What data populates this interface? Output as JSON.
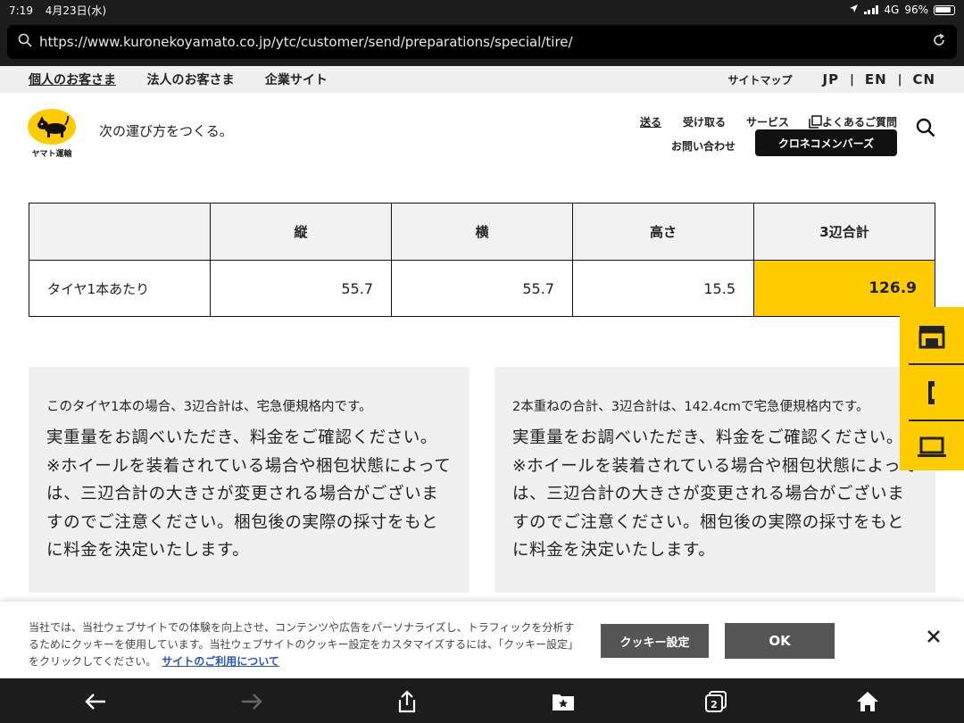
{
  "status_bar": {
    "time": "7:19",
    "date": "4月23日(水)",
    "network": "4G",
    "battery": "96%"
  },
  "browser": {
    "url": "https://www.kuronekoyamato.co.jp/ytc/customer/send/preparations/special/tire/"
  },
  "top_nav": {
    "links": [
      "個人のお客さま",
      "法人のお客さま",
      "企業サイト"
    ],
    "sitemap": "サイトマップ",
    "languages": [
      "JP",
      "EN",
      "CN"
    ],
    "separator": "|"
  },
  "header": {
    "logo_caption": "ヤマト運輸",
    "tagline": "次の運び方をつくる。",
    "nav": {
      "send": "送る",
      "receive": "受け取る",
      "service": "サービス",
      "faq": "よくあるご質問",
      "contact": "お問い合わせ",
      "members": "クロネコメンバーズ"
    }
  },
  "table": {
    "headers": [
      "",
      "縦",
      "横",
      "高さ",
      "3辺合計"
    ],
    "row": {
      "label": "タイヤ1本あたり",
      "length": "55.7",
      "width": "55.7",
      "height": "15.5",
      "total": "126.9"
    }
  },
  "info_boxes": [
    {
      "lead": "このタイヤ1本の場合、3辺合計は、宅急便規格内です。",
      "body": "実重量をお調べいただき、料金をご確認ください。※ホイールを装着されている場合や梱包状態によっては、三辺合計の大きさが変更される場合がございますのでご注意ください。梱包後の実際の採寸をもとに料金を決定いたします。"
    },
    {
      "lead": "2本重ねの合計、3辺合計は、142.4cmで宅急便規格内です。",
      "body": "実重量をお調べいただき、料金をご確認ください。※ホイールを装着されている場合や梱包状態によっては、三辺合計の大きさが変更される場合がございますのでご注意ください。梱包後の実際の採寸をもとに料金を決定いたします。"
    }
  ],
  "cookie_banner": {
    "text": "当社では、当社ウェブサイトでの体験を向上させ、コンテンツや広告をパーソナライズし、トラフィックを分析するためにクッキーを使用しています。当社ウェブサイトのクッキー設定をカスタマイズするには、「クッキー設定」をクリックしてください。",
    "link": "サイトのご利用について",
    "settings_button": "クッキー設定",
    "ok_button": "OK"
  },
  "bottom_toolbar": {
    "tab_count": "2"
  },
  "colors": {
    "brand_yellow": "#ffcc00",
    "dark": "#1c1c1c",
    "panel": "#f0f0f0"
  }
}
